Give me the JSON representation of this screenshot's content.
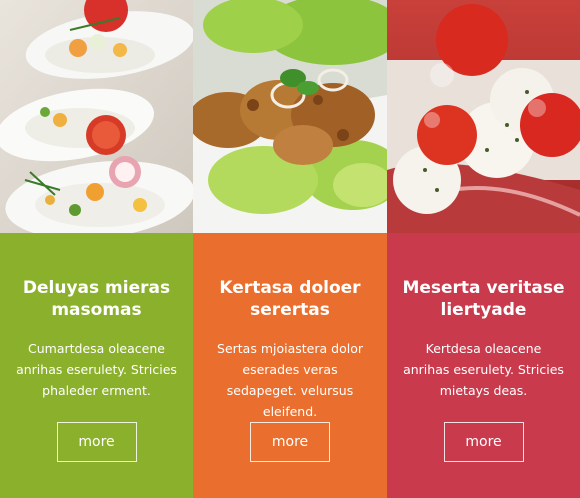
{
  "cards": [
    {
      "title": "Deluyas mieras masomas",
      "text": "Cumartdesa oleacene anrihas eserulety. Stricies phaleder erment.",
      "button": "more",
      "photo_icon": "salad-spoons-photo",
      "panel_color": "#8bb02b"
    },
    {
      "title": "Kertasa doloer serertas",
      "text": "Sertas mjoiastera dolor eserades veras sedapeget. velursus eleifend.",
      "button": "more",
      "photo_icon": "grilled-chicken-salad-photo",
      "panel_color": "#ea6f2e"
    },
    {
      "title": "Meserta veritase liertyade",
      "text": "Kertdesa oleacene anrihas eserulety. Stricies mietays deas.",
      "button": "more",
      "photo_icon": "caprese-skewer-photo",
      "panel_color": "#c93a4d"
    }
  ]
}
